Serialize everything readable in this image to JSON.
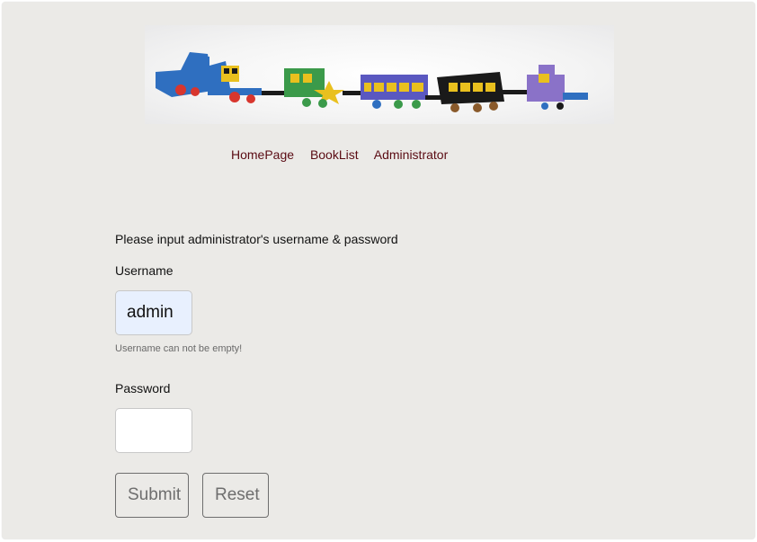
{
  "banner": {
    "icon": "toy-train-banner"
  },
  "nav": {
    "items": [
      {
        "label": "HomePage"
      },
      {
        "label": "BookList"
      },
      {
        "label": "Administrator"
      }
    ],
    "color": "#5a0b13"
  },
  "form": {
    "prompt": "Please input administrator's username & password",
    "username_label": "Username",
    "username_value": "admin",
    "username_hint": "Username can not be empty!",
    "password_label": "Password",
    "password_value": "",
    "submit_label": "Submit",
    "reset_label": "Reset"
  },
  "colors": {
    "background": "#ebeae7",
    "autofill": "#e8f0fe",
    "link": "#5a0b13"
  }
}
